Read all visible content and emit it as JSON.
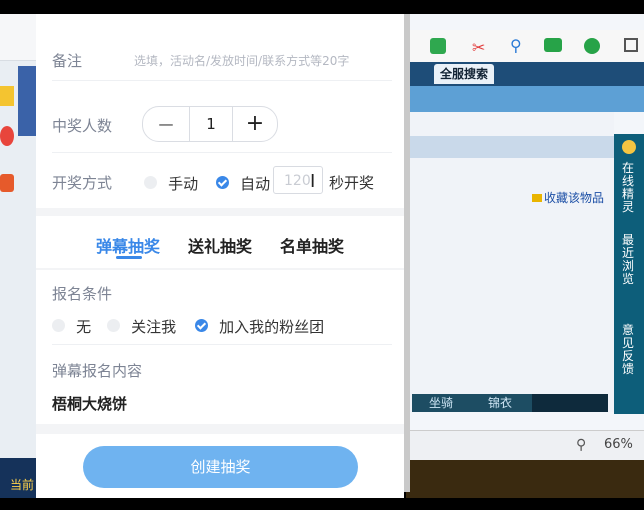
{
  "lottery_panel": {
    "remark": {
      "label": "备注",
      "placeholder": "选填，活动名/发放时间/联系方式等20字"
    },
    "winner_count": {
      "label": "中奖人数",
      "value": "1",
      "minus": "—",
      "plus": "+"
    },
    "draw_method": {
      "label": "开奖方式",
      "options": [
        {
          "label": "手动",
          "checked": false
        },
        {
          "label": "自动",
          "checked": true
        }
      ],
      "seconds_value": "120",
      "suffix": "秒开奖"
    },
    "tabs": [
      {
        "label": "弹幕抽奖",
        "active": true
      },
      {
        "label": "送礼抽奖",
        "active": false
      },
      {
        "label": "名单抽奖",
        "active": false
      }
    ],
    "signup_condition": {
      "label": "报名条件",
      "options": [
        {
          "label": "无",
          "checked": false
        },
        {
          "label": "关注我",
          "checked": false
        },
        {
          "label": "加入我的粉丝团",
          "checked": true
        }
      ]
    },
    "danmu_content": {
      "label": "弹幕报名内容",
      "value": "梧桐大烧饼"
    },
    "create_button": "创建抽奖"
  },
  "background_right": {
    "nav_tab": "全服搜索",
    "favorite_link": "收藏该物品",
    "side_panel": [
      "在线精灵",
      "最近浏览",
      "意见反馈"
    ],
    "sub_tabs": [
      "坐骑",
      "锦衣"
    ],
    "zoom": "66%"
  },
  "background_left": {
    "bottom_text": "当前"
  },
  "colors": {
    "accent": "#3a88e8",
    "button": "#6fb3f0"
  }
}
